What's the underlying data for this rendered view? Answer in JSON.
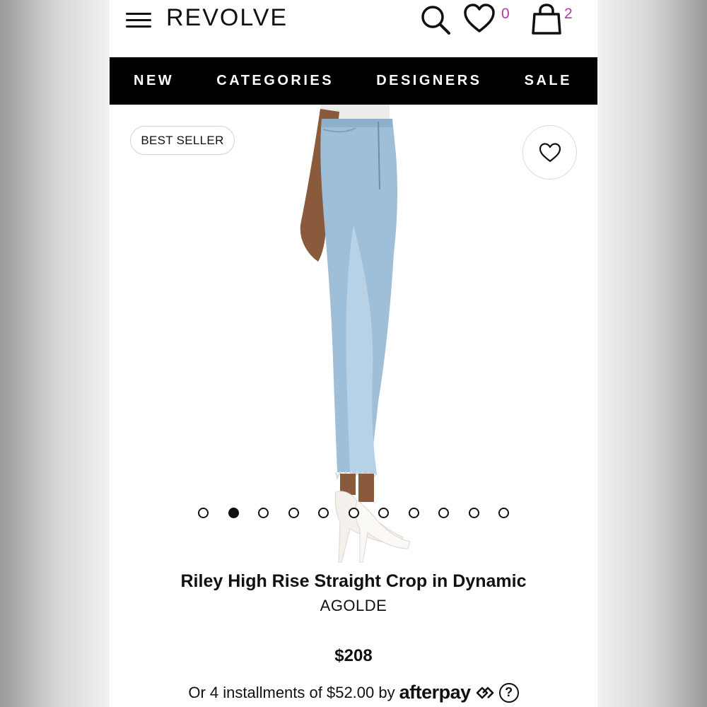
{
  "header": {
    "logo": "REVOLVE",
    "wishlist_count": "0",
    "bag_count": "2",
    "count_color": "#b23aa0",
    "icons": [
      "menu-icon",
      "search-icon",
      "heart-icon",
      "shopping-bag-icon"
    ]
  },
  "nav": {
    "items": [
      {
        "label": "NEW"
      },
      {
        "label": "CATEGORIES"
      },
      {
        "label": "DESIGNERS"
      },
      {
        "label": "SALE"
      }
    ]
  },
  "gallery": {
    "badge": "BEST SELLER",
    "favorite_icon": "heart-outline-icon",
    "image_count": 11,
    "active_index": 1
  },
  "product": {
    "title": "Riley High Rise Straight Crop in Dynamic",
    "brand": "AGOLDE",
    "price": "$208",
    "installments_text": "Or 4 installments of $52.00 by",
    "afterpay_label": "afterpay",
    "help_label": "?"
  }
}
